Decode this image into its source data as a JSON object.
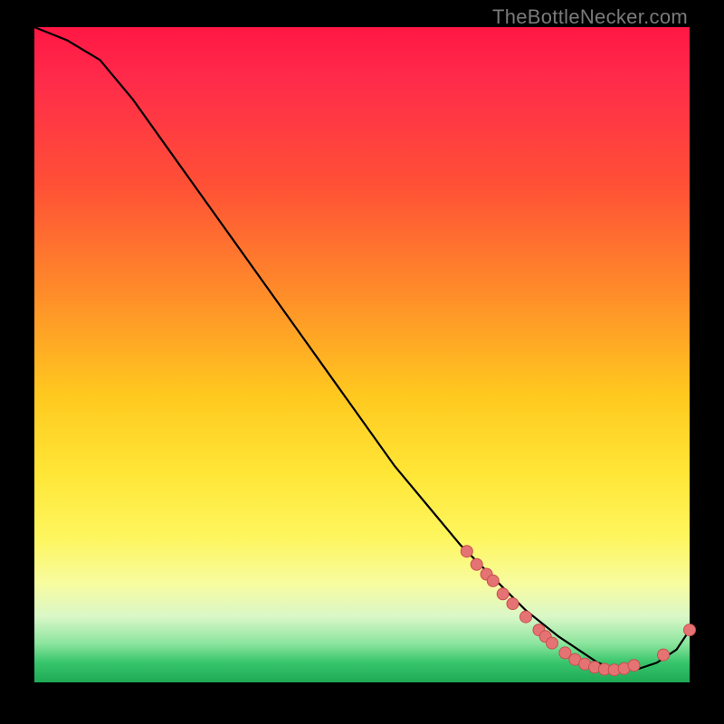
{
  "watermark": "TheBottleNecker.com",
  "chart_data": {
    "type": "line",
    "title": "",
    "xlabel": "",
    "ylabel": "",
    "xlim": [
      0,
      100
    ],
    "ylim": [
      0,
      100
    ],
    "series": [
      {
        "name": "bottleneck-curve",
        "x": [
          0,
          5,
          10,
          15,
          20,
          25,
          30,
          35,
          40,
          45,
          50,
          55,
          60,
          65,
          70,
          75,
          80,
          83,
          86,
          89,
          92,
          95,
          98,
          100
        ],
        "y": [
          100,
          98,
          95,
          89,
          82,
          75,
          68,
          61,
          54,
          47,
          40,
          33,
          27,
          21,
          16,
          11,
          7,
          5,
          3,
          2,
          2,
          3,
          5,
          8
        ]
      }
    ],
    "markers": [
      {
        "x": 66,
        "y": 20
      },
      {
        "x": 67.5,
        "y": 18
      },
      {
        "x": 69,
        "y": 16.5
      },
      {
        "x": 70,
        "y": 15.5
      },
      {
        "x": 71.5,
        "y": 13.5
      },
      {
        "x": 73,
        "y": 12
      },
      {
        "x": 75,
        "y": 10
      },
      {
        "x": 77,
        "y": 8
      },
      {
        "x": 78,
        "y": 7
      },
      {
        "x": 79,
        "y": 6
      },
      {
        "x": 81,
        "y": 4.5
      },
      {
        "x": 82.5,
        "y": 3.5
      },
      {
        "x": 84,
        "y": 2.8
      },
      {
        "x": 85.5,
        "y": 2.3
      },
      {
        "x": 87,
        "y": 2.0
      },
      {
        "x": 88.5,
        "y": 1.9
      },
      {
        "x": 90,
        "y": 2.1
      },
      {
        "x": 91.5,
        "y": 2.6
      },
      {
        "x": 96,
        "y": 4.2
      },
      {
        "x": 100,
        "y": 8
      }
    ],
    "marker_label": {
      "text": "",
      "x": 86,
      "y": 3.5
    },
    "colors": {
      "curve": "#000000",
      "marker_fill": "#e57373",
      "marker_stroke": "#c94f4f"
    }
  }
}
